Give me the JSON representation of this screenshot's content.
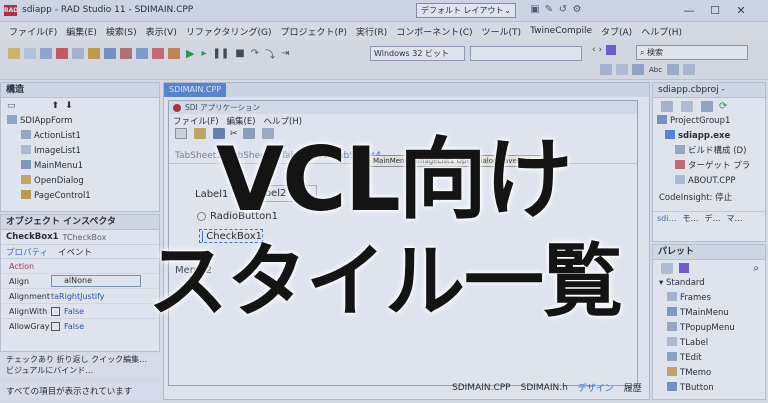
{
  "window": {
    "title": "sdiapp - RAD Studio 11 - SDIMAIN.CPP",
    "app_badge": "RAD",
    "layout_combo": "デフォルト レイアウト",
    "min": "—",
    "max": "☐",
    "close": "✕"
  },
  "menu": [
    "ファイル(F)",
    "編集(E)",
    "検索(S)",
    "表示(V)",
    "リファクタリング(G)",
    "プロジェクト(P)",
    "実行(R)",
    "コンポーネント(C)",
    "ツール(T)",
    "TwineCompile",
    "タブ(A)",
    "ヘルプ(H)"
  ],
  "toolbar": {
    "platform": "Windows 32 ビット",
    "search_placeholder": "検索",
    "abc": "Abc"
  },
  "structure_panel": {
    "title": "構造",
    "items": [
      "SDIAppForm",
      "ActionList1",
      "ImageList1",
      "MainMenu1",
      "OpenDialog",
      "PageControl1"
    ]
  },
  "inspector": {
    "title": "オブジェクト インスペクタ",
    "object": "CheckBox1",
    "object_type": "TCheckBox",
    "tabs": [
      "プロパティ",
      "イベント"
    ],
    "rows": [
      {
        "name": "Action",
        "value": ""
      },
      {
        "name": "Align",
        "value": "alNone"
      },
      {
        "name": "Alignment",
        "value": "taRightJustify"
      },
      {
        "name": "AlignWith",
        "value": "False"
      },
      {
        "name": "AllowGray",
        "value": "False"
      }
    ],
    "footer_links": "チェックあり 折り返し クイック編集…",
    "footer_bind": "ビジュアルにバインド…",
    "status": "すべての項目が表示されています"
  },
  "editor": {
    "file_tab": "SDIMAIN.CPP",
    "form_caption": "SDI アプリケーション",
    "form_menu": [
      "ファイル(F)",
      "編集(E)",
      "ヘルプ(H)"
    ],
    "page_tabs": [
      "TabSheet1",
      "TabSheet2",
      "TabSheet3",
      "TabSheet4"
    ],
    "hint": "MainMenu1 ImageList1 OpenDialog SaveDialog",
    "label1": "Label1",
    "label2": "Label2",
    "radio": "RadioButton1",
    "check": "CheckBox1",
    "memo": "Memo2",
    "bottom_tabs": [
      "SDIMAIN.CPP",
      "SDIMAIN.h",
      "デザイン",
      "履歴"
    ]
  },
  "project_panel": {
    "title": "sdiapp.cbproj -",
    "items": [
      "ProjectGroup1",
      "sdiapp.exe",
      "ビルド構成 (D)",
      "ターゲット プラ",
      "ABOUT.CPP"
    ],
    "codeinsight": "CodeInsight: 停止",
    "tabs": [
      "sdi…",
      "モ…",
      "デ…",
      "マ…"
    ]
  },
  "palette": {
    "title": "パレット",
    "category": "Standard",
    "items": [
      "Frames",
      "TMainMenu",
      "TPopupMenu",
      "TLabel",
      "TEdit",
      "TMemo",
      "TButton"
    ]
  },
  "overlay": {
    "line1": "VCL向け",
    "line2": "スタイル一覧"
  },
  "colors": {
    "accent": "#3f6fbf",
    "tab_active": "#5b8bd6",
    "overlay_tint": "#6a8cc8"
  }
}
